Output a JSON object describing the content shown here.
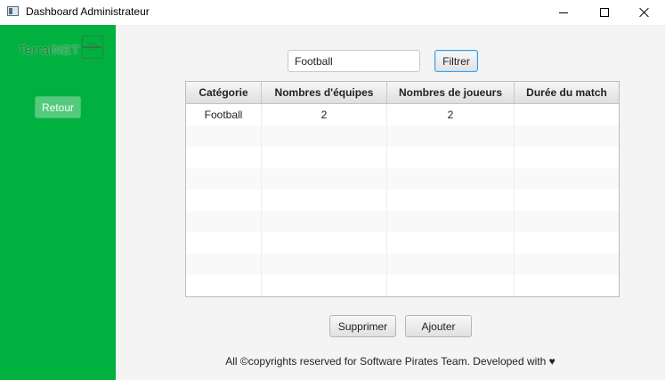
{
  "window": {
    "title": "Dashboard Administrateur"
  },
  "sidebar": {
    "logo_part1": "Terrai",
    "logo_part2": "NET",
    "back_label": "Retour",
    "color": "#00b140"
  },
  "filter": {
    "value": "Football",
    "placeholder": "",
    "button_label": "Filtrer"
  },
  "table": {
    "headers": [
      "Catégorie",
      "Nombres d'équipes",
      "Nombres de joueurs",
      "Durée du match"
    ],
    "rows": [
      [
        "Football",
        "2",
        "2",
        ""
      ]
    ]
  },
  "actions": {
    "delete_label": "Supprimer",
    "add_label": "Ajouter"
  },
  "footer": {
    "text": "All ©copyrights reserved for Software Pirates Team. Developed with ♥"
  }
}
